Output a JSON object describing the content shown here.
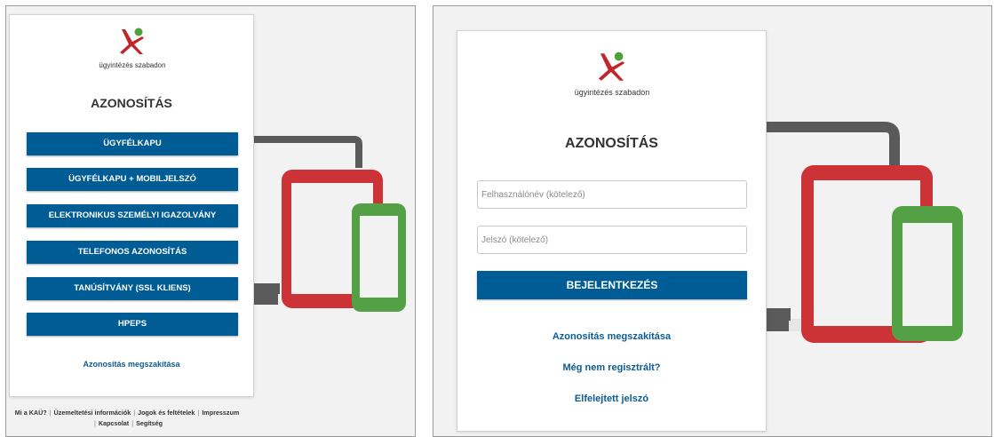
{
  "left_screen": {
    "logo_caption": "ügyintézés szabadon",
    "heading": "AZONOSÍTÁS",
    "buttons": [
      "ÜGYFÉLKAPU",
      "ÜGYFÉLKAPU + MOBILJELSZÓ",
      "ELEKTRONIKUS SZEMÉLYI IGAZOLVÁNY",
      "TELEFONOS AZONOSÍTÁS",
      "TANÚSÍTVÁNY (SSL KLIENS)",
      "HPEPS"
    ],
    "cancel_link": "Azonosítás megszakítása",
    "footer": {
      "links": [
        "Mi a KAÜ?",
        "Üzemeltetési információk",
        "Jogok és feltételek",
        "Impresszum",
        "Kapcsolat",
        "Segítség"
      ],
      "separator": "|"
    }
  },
  "right_screen": {
    "logo_caption": "ügyintézés szabadon",
    "heading": "AZONOSÍTÁS",
    "username_placeholder": "Felhasználónév (kötelező)",
    "password_placeholder": "Jelszó (kötelező)",
    "login_button": "BEJELENTKEZÉS",
    "cancel_link": "Azonosítás megszakítása",
    "register_link": "Még nem regisztrált?",
    "forgot_link": "Elfelejtett jelszó"
  },
  "colors": {
    "button_blue": "#005c95",
    "link_blue": "#0b5c93",
    "logo_red": "#c0272d",
    "logo_green": "#4ea038",
    "tablet_red": "#cc3336",
    "phone_green": "#54a044",
    "laptop_gray": "#555555",
    "panel_bg": "#f2f2f2"
  },
  "icons": [
    "kau-logo-icon",
    "laptop-illustration",
    "tablet-illustration",
    "phone-illustration"
  ]
}
